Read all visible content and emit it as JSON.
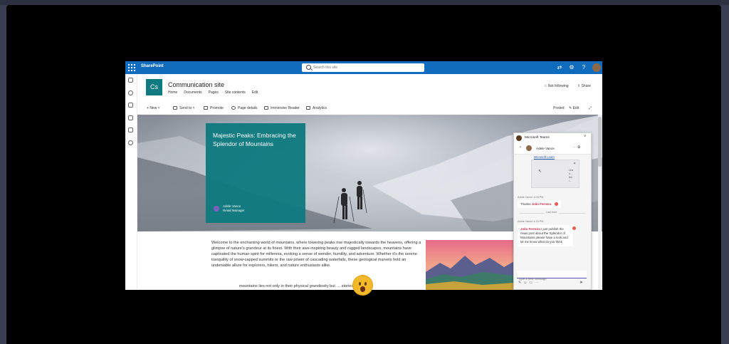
{
  "suite_bar": {
    "app_name": "SharePoint",
    "search_placeholder": "Search this site",
    "icons": [
      "waffle-icon",
      "sync-icon",
      "settings-icon",
      "help-icon"
    ]
  },
  "site": {
    "logo_text": "Cs",
    "title": "Communication site",
    "nav": [
      "Home",
      "Documents",
      "Pages",
      "Site contents",
      "Edit"
    ],
    "follow_label": "Not following",
    "share_label": "Share"
  },
  "command_bar": {
    "new_label": "New",
    "send_label": "Send to",
    "promote_label": "Promote",
    "details_label": "Page details",
    "reader_label": "Immersive Reader",
    "analytics_label": "Analytics",
    "posted_label": "Posted",
    "edit_label": "Edit"
  },
  "hero": {
    "title": "Majestic Peaks: Embracing the Splendor of Mountains",
    "author_name": "Adele Vance",
    "author_role": "Retail Manager"
  },
  "article": {
    "paragraph1": "Welcome to the enchanting world of mountains, where towering peaks rise majestically towards the heavens, offering a glimpse of nature's grandeur at its finest. With their awe-inspiring beauty and rugged landscapes, mountains have captivated the human spirit for millennia, evoking a sense of wonder, humility, and adventure. Whether it's the serene tranquility of snow-capped summits or the raw power of cascading waterfalls, these geological marvels hold an undeniable allure for explorers, hikers, and nature enthusiasts alike.",
    "paragraph2": "mountains lies not only in their physical grandiosity but … stories they tell"
  },
  "teams": {
    "title": "Microsoft Teams",
    "chat_name": "Adele Vance",
    "link_text": "Microsoft Learn",
    "preview_text": "Lea\nn...\nbui\nl...",
    "msg1_meta": "Adele Vance 4:05 PM",
    "msg1_prefix": "Thanks",
    "msg1_mention": "João Ferreira",
    "separator": "Last read",
    "msg2_meta": "Adele Vance 4:15 PM",
    "msg2_mention": "João Ferreira",
    "msg2_text": " I just publish the news post about the Splendor of Mountains please have a look and let me know what do you think",
    "compose_placeholder": "Type a new message"
  },
  "colors": {
    "suite_bar": "#0f6cbd",
    "site_accent": "#0f7a80",
    "mention": "#c4314b"
  }
}
